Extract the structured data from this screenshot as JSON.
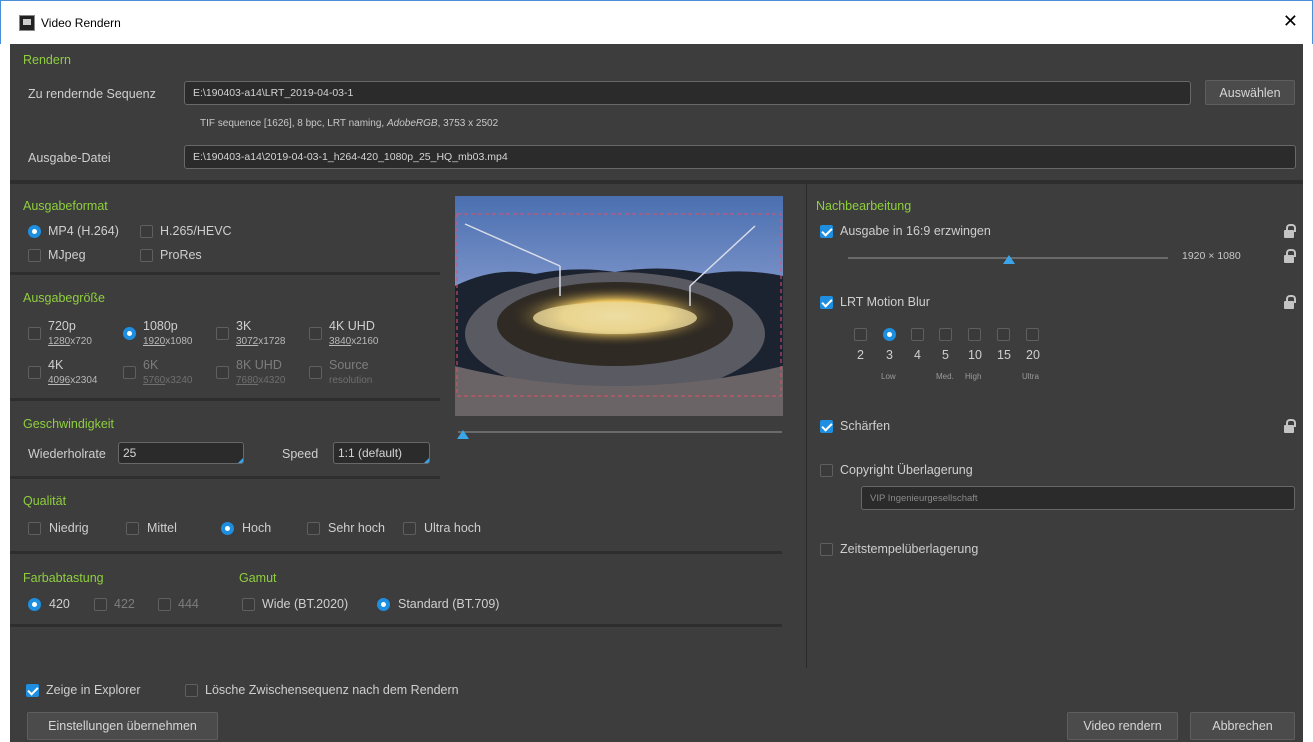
{
  "window": {
    "title": "Video Rendern",
    "close": "✕"
  },
  "rendern": {
    "section": "Rendern",
    "sequence_label": "Zu rendernde Sequenz",
    "sequence_value": "E:\\190403-a14\\LRT_2019-04-03-1",
    "choose_button": "Auswählen",
    "sequence_info_pre": "TIF sequence [1626], 8 bpc, LRT naming, ",
    "sequence_info_colorspace": "AdobeRGB",
    "sequence_info_post": ", 3753 x 2502",
    "output_label": "Ausgabe-Datei",
    "output_value": "E:\\190403-a14\\2019-04-03-1_h264-420_1080p_25_HQ_mb03.mp4"
  },
  "format": {
    "section": "Ausgabeformat",
    "options": [
      {
        "label": "MP4 (H.264)",
        "selected": true
      },
      {
        "label": "H.265/HEVC",
        "selected": false
      },
      {
        "label": "MJpeg",
        "selected": false
      },
      {
        "label": "ProRes",
        "selected": false
      }
    ]
  },
  "size": {
    "section": "Ausgabegröße",
    "options": [
      {
        "label": "720p",
        "w": "1280",
        "h": "720",
        "selected": false,
        "enabled": true
      },
      {
        "label": "1080p",
        "w": "1920",
        "h": "1080",
        "selected": true,
        "enabled": true
      },
      {
        "label": "3K",
        "w": "3072",
        "h": "1728",
        "selected": false,
        "enabled": true
      },
      {
        "label": "4K UHD",
        "w": "3840",
        "h": "2160",
        "selected": false,
        "enabled": true
      },
      {
        "label": "4K",
        "w": "4096",
        "h": "2304",
        "selected": false,
        "enabled": true
      },
      {
        "label": "6K",
        "w": "5760",
        "h": "3240",
        "selected": false,
        "enabled": false
      },
      {
        "label": "8K UHD",
        "w": "7680",
        "h": "4320",
        "selected": false,
        "enabled": false
      },
      {
        "label": "Source",
        "sub": "resolution",
        "selected": false,
        "enabled": false
      }
    ]
  },
  "speed": {
    "section": "Geschwindigkeit",
    "rate_label": "Wiederholrate",
    "rate_value": "25",
    "speed_label": "Speed",
    "speed_value": "1:1 (default)"
  },
  "quality": {
    "section": "Qualität",
    "options": [
      {
        "label": "Niedrig",
        "selected": false
      },
      {
        "label": "Mittel",
        "selected": false
      },
      {
        "label": "Hoch",
        "selected": true
      },
      {
        "label": "Sehr hoch",
        "selected": false
      },
      {
        "label": "Ultra hoch",
        "selected": false
      }
    ]
  },
  "sampling": {
    "section": "Farbabtastung",
    "options": [
      {
        "label": "420",
        "selected": true,
        "enabled": true
      },
      {
        "label": "422",
        "selected": false,
        "enabled": false
      },
      {
        "label": "444",
        "selected": false,
        "enabled": false
      }
    ]
  },
  "gamut": {
    "section": "Gamut",
    "options": [
      {
        "label": "Wide (BT.2020)",
        "selected": false
      },
      {
        "label": "Standard (BT.709)",
        "selected": true
      }
    ]
  },
  "post": {
    "section": "Nachbearbeitung",
    "force169": {
      "label": "Ausgabe in 16:9 erzwingen",
      "checked": true
    },
    "resolution_readout": "1920 × 1080",
    "motion_blur": {
      "label": "LRT Motion Blur",
      "checked": true
    },
    "blur_levels": [
      {
        "num": "2",
        "tag": "",
        "selected": false
      },
      {
        "num": "3",
        "tag": "Low",
        "selected": true
      },
      {
        "num": "4",
        "tag": "",
        "selected": false
      },
      {
        "num": "5",
        "tag": "Med.",
        "selected": false
      },
      {
        "num": "10",
        "tag": "High",
        "selected": false
      },
      {
        "num": "15",
        "tag": "",
        "selected": false
      },
      {
        "num": "20",
        "tag": "Ultra",
        "selected": false
      }
    ],
    "sharpen": {
      "label": "Schärfen",
      "checked": true
    },
    "copyright": {
      "label": "Copyright Überlagerung",
      "checked": false,
      "placeholder": "VIP Ingenieurgesellschaft"
    },
    "timestamp": {
      "label": "Zeitstempelüberlagerung",
      "checked": false
    }
  },
  "footer": {
    "show_explorer": {
      "label": "Zeige in Explorer",
      "checked": true
    },
    "delete_intermediate": {
      "label": "Lösche Zwischensequenz nach dem Rendern",
      "checked": false
    },
    "apply_settings": "Einstellungen übernehmen",
    "render_video": "Video rendern",
    "cancel": "Abbrechen"
  },
  "colors": {
    "accent": "#1e8fe0",
    "section_green": "#8ecf3e",
    "panel": "#3d3d3d",
    "slider_thumb": "#3aa5e8"
  }
}
